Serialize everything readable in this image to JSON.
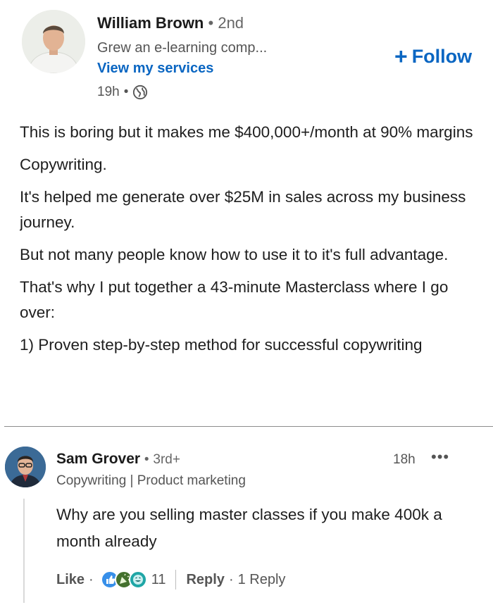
{
  "author": {
    "name": "William Brown",
    "separator": "•",
    "degree": "2nd",
    "headline": "Grew an e-learning comp...",
    "services_link": "View my services",
    "time": "19h",
    "meta_separator": "•",
    "visibility_icon": "globe-icon"
  },
  "follow": {
    "plus": "+",
    "label": "Follow"
  },
  "post": {
    "paragraphs": [
      "This is boring but it makes me $400,000+/month at 90% margins",
      "Copywriting.",
      "It's helped me generate over $25M in sales across my business journey.",
      "But not many people know how to use it to it's full advantage.",
      "That's why I put together a 43-minute Masterclass where I go over:",
      "1) Proven step-by-step method for successful copywriting"
    ]
  },
  "comment": {
    "name": "Sam Grover",
    "separator": "•",
    "degree": "3rd+",
    "headline": "Copywriting | Product marketing",
    "time": "18h",
    "more": "•••",
    "text": "Why are you selling master classes if you make 400k a month already",
    "actions": {
      "like": "Like",
      "dot": "·",
      "reaction_count": "11",
      "reaction_icons": [
        "like-icon",
        "celebrate-icon",
        "funny-icon"
      ],
      "reply": "Reply",
      "reply_count": "1 Reply"
    }
  },
  "colors": {
    "link": "#0a66c2",
    "muted": "#555555",
    "text": "#1e1e1e"
  }
}
